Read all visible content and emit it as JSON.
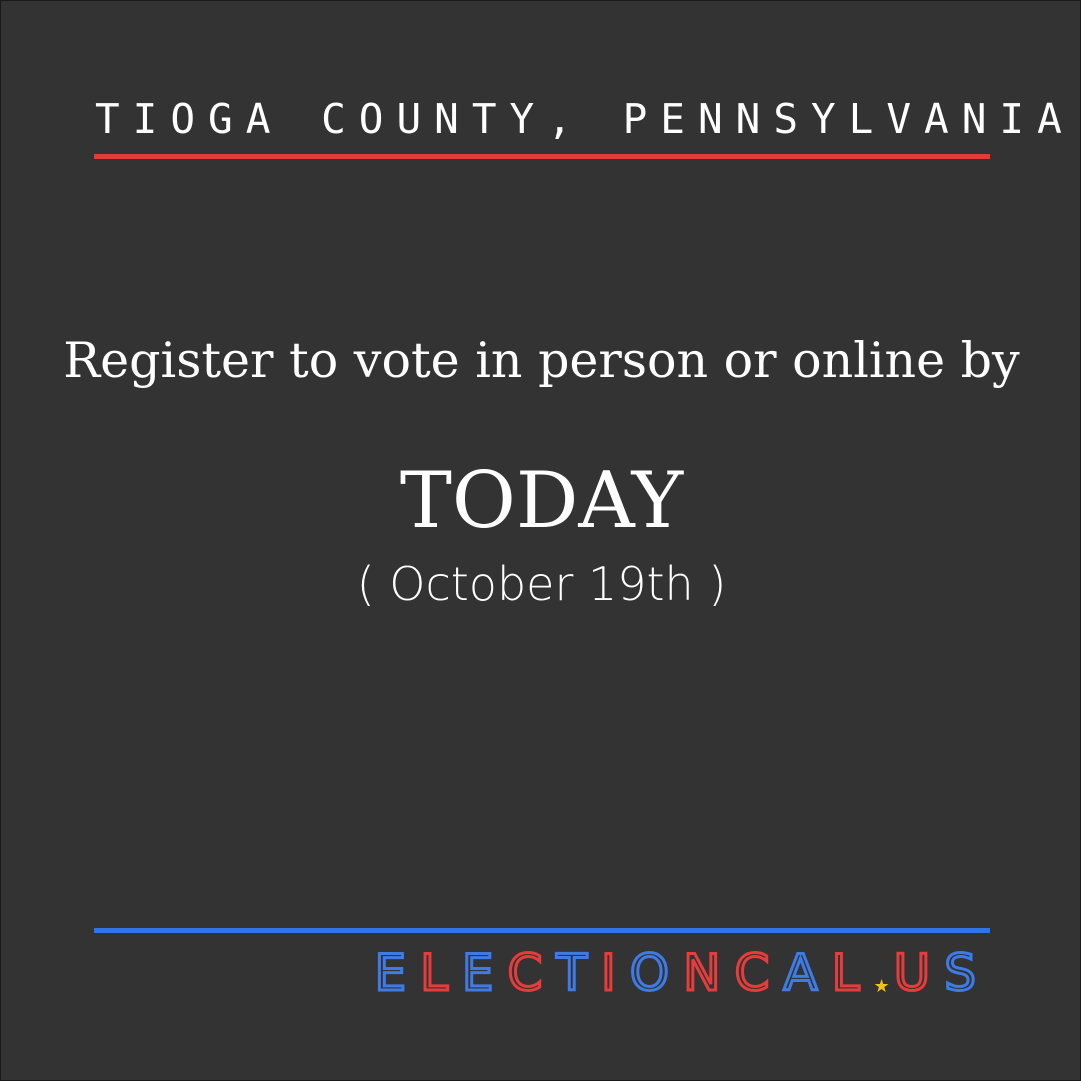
{
  "header": {
    "county": "TIOGA COUNTY, PENNSYLVANIA"
  },
  "message": {
    "line1": "Register to vote in person or online by",
    "deadline": "TODAY",
    "date": "( October 19th )"
  },
  "logo": {
    "part1": "ELECTION",
    "part2": "CAL",
    "part3": "US",
    "star_glyph": "★",
    "colors": {
      "red": "#e63c3c",
      "blue": "#3f7be6",
      "star": "#f2c21b"
    }
  },
  "colors": {
    "background": "#333333",
    "top_rule": "#e53a3a",
    "bottom_rule": "#2f74e8",
    "text": "#ffffff"
  }
}
